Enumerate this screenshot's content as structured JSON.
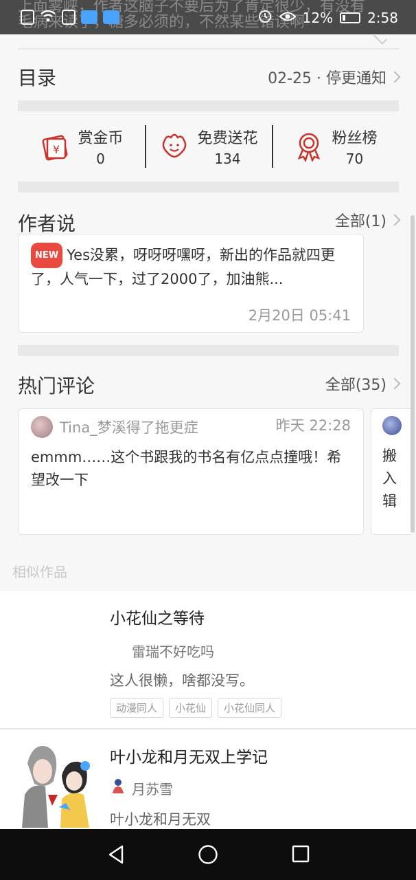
{
  "status_bar": {
    "bg_text_line1": "上面雾峡，作者这脑子不要后为了肯定很少，有没有",
    "bg_text_line2": "毛病来读了，糖多必须的，不然某些错误啊",
    "battery_percent": "12%",
    "time": "2:58"
  },
  "toc": {
    "title": "目录",
    "latest": "02-25 · 停更通知"
  },
  "stats": [
    {
      "label": "赏金币",
      "value": "0",
      "icon": "coin-envelope-icon"
    },
    {
      "label": "免费送花",
      "value": "134",
      "icon": "flower-icon"
    },
    {
      "label": "粉丝榜",
      "value": "70",
      "icon": "medal-icon"
    }
  ],
  "author_says": {
    "title": "作者说",
    "all_link": "全部(1)",
    "badge": "NEW",
    "text": "Yes没累，呀呀呀嘿呀，新出的作品就四更了，人气一下，过了2000了，加油熊...",
    "time": "2月20日  05:41"
  },
  "hot_comments": {
    "title": "热门评论",
    "all_link": "全部(35)",
    "items": [
      {
        "user": "Tina_梦溪得了拖更症",
        "time": "昨天 22:28",
        "text": "emmm……这个书跟我的书名有亿点点撞哦！希望改一下"
      },
      {
        "partial_text_lines": [
          "搬",
          "入",
          "辑"
        ]
      }
    ]
  },
  "similar": {
    "label": "相似作品",
    "books": [
      {
        "title": "小花仙之等待",
        "author": "雷瑞不好吃吗",
        "desc": "这人很懒，啥都没写。",
        "tags": [
          "动漫同人",
          "小花仙",
          "小花仙同人"
        ]
      },
      {
        "title": "叶小龙和月无双上学记",
        "author": "月苏雪",
        "desc": "叶小龙和月无双",
        "tags": []
      }
    ]
  },
  "colors": {
    "accent_red": "#c8342c",
    "badge_red": "#e84a3f"
  }
}
